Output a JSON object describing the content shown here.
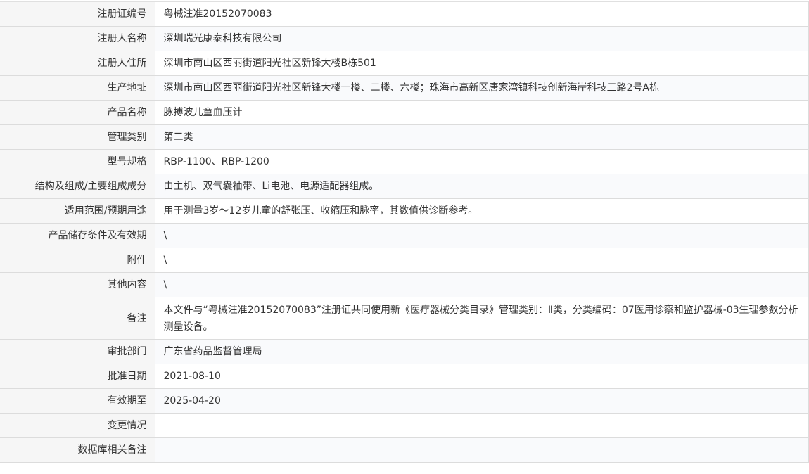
{
  "rows": [
    {
      "label": "注册证编号",
      "value": "粤械注准20152070083"
    },
    {
      "label": "注册人名称",
      "value": "深圳瑞光康泰科技有限公司"
    },
    {
      "label": "注册人住所",
      "value": "深圳市南山区西丽街道阳光社区新锋大楼B栋501"
    },
    {
      "label": "生产地址",
      "value": "深圳市南山区西丽街道阳光社区新锋大楼一楼、二楼、六楼；珠海市高新区唐家湾镇科技创新海岸科技三路2号A栋"
    },
    {
      "label": "产品名称",
      "value": "脉搏波儿童血压计"
    },
    {
      "label": "管理类别",
      "value": "第二类"
    },
    {
      "label": "型号规格",
      "value": "RBP-1100、RBP-1200"
    },
    {
      "label": "结构及组成/主要组成成分",
      "value": "由主机、双气囊袖带、Li电池、电源适配器组成。"
    },
    {
      "label": "适用范围/预期用途",
      "value": "用于测量3岁～12岁儿童的舒张压、收缩压和脉率，其数值供诊断参考。"
    },
    {
      "label": "产品储存条件及有效期",
      "value": "\\"
    },
    {
      "label": "附件",
      "value": "\\"
    },
    {
      "label": "其他内容",
      "value": "\\"
    },
    {
      "label": "备注",
      "value": "本文件与“粤械注准20152070083”注册证共同使用新《医疗器械分类目录》管理类别：Ⅱ类，分类编码：07医用诊察和监护器械-03生理参数分析测量设备。"
    },
    {
      "label": "审批部门",
      "value": "广东省药品监督管理局"
    },
    {
      "label": "批准日期",
      "value": "2021-08-10"
    },
    {
      "label": "有效期至",
      "value": "2025-04-20"
    },
    {
      "label": "变更情况",
      "value": ""
    },
    {
      "label": "数据库相关备注",
      "value": ""
    }
  ]
}
